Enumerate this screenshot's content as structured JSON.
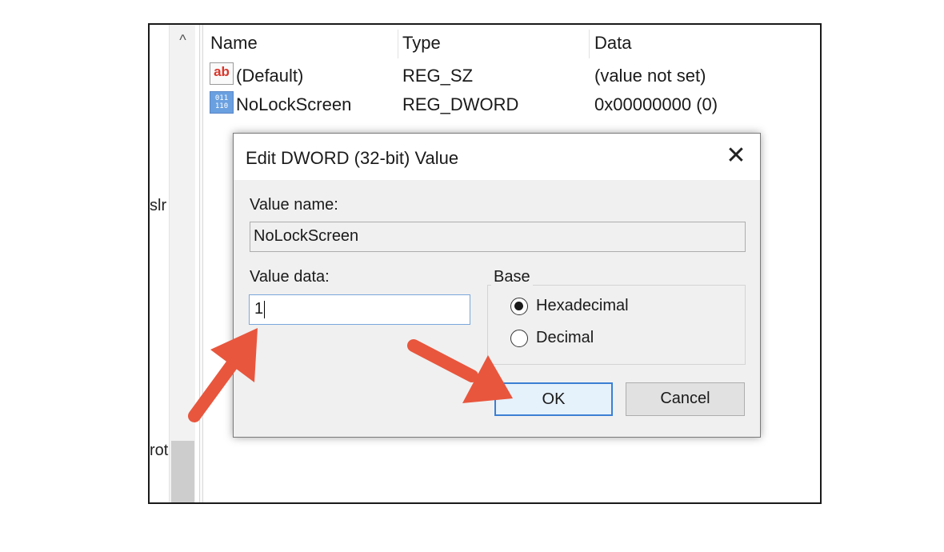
{
  "tree": {
    "fragment_1": "slr",
    "fragment_2": "rot",
    "scroll_up_glyph": "^"
  },
  "list": {
    "headers": {
      "name": "Name",
      "type": "Type",
      "data": "Data"
    },
    "rows": [
      {
        "icon": "string-value-icon",
        "icon_text": "ab",
        "name": "(Default)",
        "type": "REG_SZ",
        "data": "(value not set)"
      },
      {
        "icon": "dword-value-icon",
        "icon_text": "011\n110",
        "name": "NoLockScreen",
        "type": "REG_DWORD",
        "data": "0x00000000 (0)"
      }
    ]
  },
  "dialog": {
    "title": "Edit DWORD (32-bit) Value",
    "close_glyph": "✕",
    "value_name_label": "Value name:",
    "value_name": "NoLockScreen",
    "value_data_label": "Value data:",
    "value_data": "1",
    "base_label": "Base",
    "base_options": [
      {
        "label": "Hexadecimal",
        "selected": true
      },
      {
        "label": "Decimal",
        "selected": false
      }
    ],
    "ok_label": "OK",
    "cancel_label": "Cancel"
  },
  "colors": {
    "arrow": "#e8563d",
    "focus_border": "#3c7fd4"
  }
}
